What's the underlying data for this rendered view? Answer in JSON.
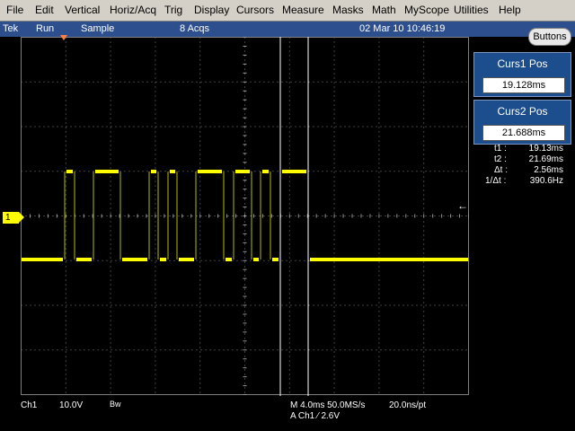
{
  "menu": [
    "File",
    "Edit",
    "Vertical",
    "Horiz/Acq",
    "Trig",
    "Display",
    "Cursors",
    "Measure",
    "Masks",
    "Math",
    "MyScope",
    "Utilities",
    "Help"
  ],
  "status": {
    "brand": "Tek",
    "run": "Run",
    "mode": "Sample",
    "acqs": "8 Acqs",
    "datetime": "02 Mar 10 10:46:19"
  },
  "buttons_label": "Buttons",
  "cursor1": {
    "title": "Curs1 Pos",
    "value": "19.128ms"
  },
  "cursor2": {
    "title": "Curs2 Pos",
    "value": "21.688ms"
  },
  "measurements": [
    {
      "label": "t1 :",
      "value": "19.13ms"
    },
    {
      "label": "t2 :",
      "value": "21.69ms"
    },
    {
      "label": "Δt :",
      "value": "2.56ms"
    },
    {
      "label": "1/Δt :",
      "value": "390.6Hz"
    }
  ],
  "channel_marker": "1",
  "bottom": {
    "channel": "Ch1",
    "scale": "10.0V",
    "bw": "Bw",
    "timebase": "M 4.0ms 50.0MS/s",
    "resolution": "20.0ns/pt",
    "trigger": "A  Ch1  ⁄  2.6V"
  },
  "colors": {
    "trace": "#ffff00",
    "cursor": "#ffffff",
    "grid": "#7f7f7f",
    "panel": "#1c4d8c"
  },
  "icons": {
    "trigger_level": "left-arrow-icon",
    "trigger_position": "down-triangle-icon"
  }
}
